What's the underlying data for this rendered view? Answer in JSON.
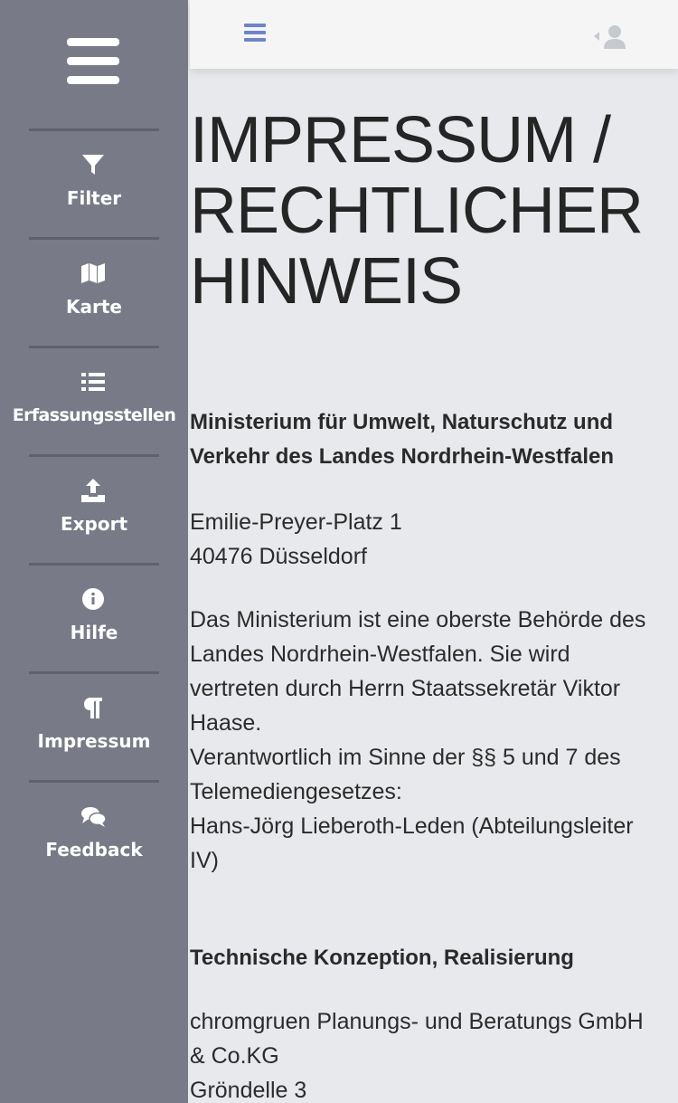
{
  "sidebar": {
    "items": [
      {
        "label": "Filter",
        "icon": "filter-icon"
      },
      {
        "label": "Karte",
        "icon": "map-icon"
      },
      {
        "label": "Erfassungsstellen",
        "icon": "list-icon"
      },
      {
        "label": "Export",
        "icon": "upload-icon"
      },
      {
        "label": "Hilfe",
        "icon": "info-icon"
      },
      {
        "label": "Impressum",
        "icon": "paragraph-icon"
      },
      {
        "label": "Feedback",
        "icon": "comments-icon"
      }
    ]
  },
  "topbar": {
    "menu_icon": "bars-icon",
    "user_icon": "user-icon",
    "accent_color": "#6d84c9"
  },
  "page": {
    "title_lines": [
      "IMPRESSUM /",
      "RECHTLICHER",
      "HINWEIS"
    ],
    "ministry_lines": [
      "Ministerium für Umwelt, Naturschutz und",
      "Verkehr des Landes Nordrhein-Westfalen"
    ],
    "address_lines": [
      "Emilie-Preyer-Platz 1",
      "40476 Düsseldorf"
    ],
    "description_lines": [
      "Das Ministerium ist eine oberste Behörde des",
      "Landes Nordrhein-Westfalen. Sie wird",
      "vertreten durch Herrn Staatssekretär Viktor",
      "Haase.",
      "Verantwortlich im Sinne der §§ 5 und 7 des",
      "Telemediengesetzes:",
      "Hans-Jörg Lieberoth-Leden (Abteilungsleiter",
      "IV)"
    ],
    "tech_heading": "Technische Konzeption, Realisierung",
    "company_lines": [
      "chromgruen Planungs- und Beratungs GmbH",
      "& Co.KG",
      "Gröndelle 3"
    ]
  }
}
